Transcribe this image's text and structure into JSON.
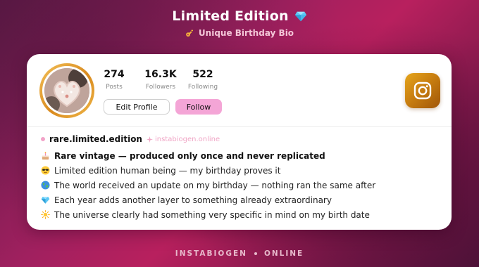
{
  "header": {
    "title": "Limited Edition",
    "subtitle": "Unique Birthday Bio"
  },
  "profile": {
    "stats": [
      {
        "value": "274",
        "label": "Posts"
      },
      {
        "value": "16.3K",
        "label": "Followers"
      },
      {
        "value": "522",
        "label": "Following"
      }
    ],
    "edit_label": "Edit Profile",
    "follow_label": "Follow",
    "handle": "rare.limited.edition",
    "website": "instabiogen.online"
  },
  "bio_lines": [
    {
      "icon": "cake-icon",
      "text": "Rare vintage — produced only once and never replicated"
    },
    {
      "icon": "sunglasses-face-icon",
      "text": "Limited edition human being — my birthday proves it"
    },
    {
      "icon": "globe-icon",
      "text": "The world received an update on my birthday — nothing ran the same after"
    },
    {
      "icon": "gem-icon",
      "text": "Each year adds another layer to something already extraordinary"
    },
    {
      "icon": "sun-icon",
      "text": "The universe clearly had something very specific in mind on my birth date"
    }
  ],
  "footer": {
    "left": "INSTABIOGEN",
    "right": "ONLINE"
  },
  "colors": {
    "background_accent": "#b8205e",
    "follow_button": "#f4a5d6",
    "instagram_badge": "#d9901a",
    "avatar_ring": "#e7a431"
  }
}
